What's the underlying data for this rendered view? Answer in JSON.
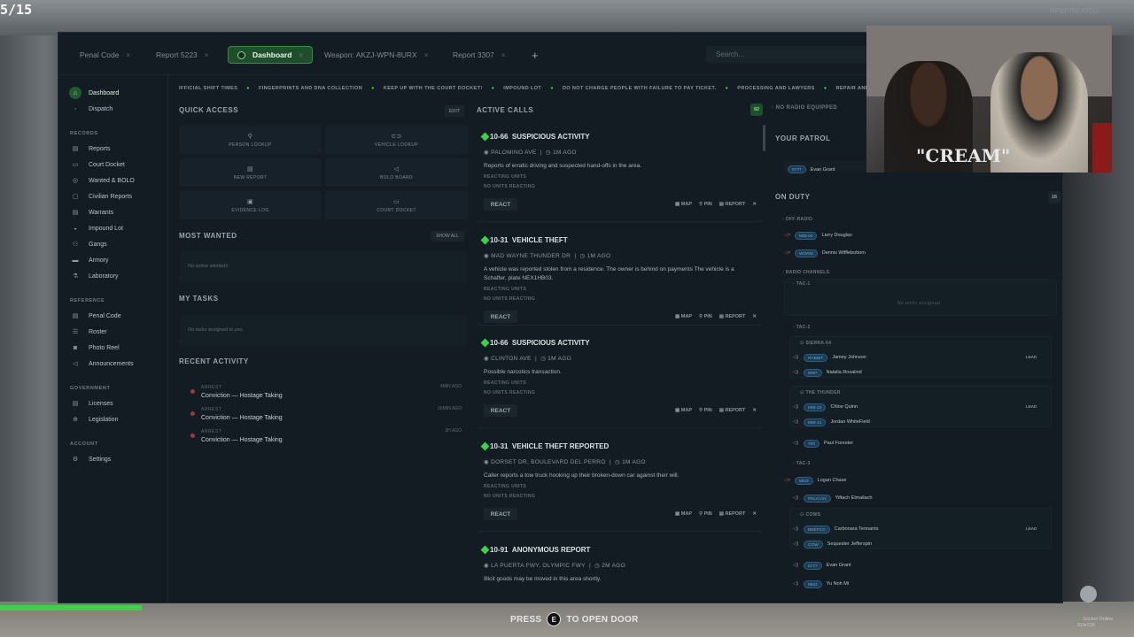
{
  "overlay": {
    "counter": "5/15",
    "watermark": "RPBP/SEATOJ",
    "prompt_press": "PRESS",
    "prompt_key": "E",
    "prompt_action": "TO OPEN DOOR",
    "socket_status": "Socket Online",
    "socket_id": "01fe209"
  },
  "tabs": [
    {
      "label": "Penal Code"
    },
    {
      "label": "Report 5223"
    },
    {
      "label": "Dashboard"
    },
    {
      "label": "Weapon: AKZJ-WPN-8URX"
    },
    {
      "label": "Report 3307"
    }
  ],
  "tab_close": "×",
  "tab_add": "+",
  "search": {
    "placeholder": "Search..."
  },
  "sidebar": {
    "top": [
      {
        "label": "Dashboard",
        "icon": "home-icon"
      },
      {
        "label": "Dispatch",
        "icon": "radio-icon"
      }
    ],
    "records_title": "RECORDS",
    "records": [
      {
        "label": "Reports",
        "icon": "document-icon"
      },
      {
        "label": "Court Docket",
        "icon": "gavel-icon"
      },
      {
        "label": "Wanted & BOLO",
        "icon": "target-icon"
      },
      {
        "label": "Civilian Reports",
        "icon": "chat-icon"
      },
      {
        "label": "Warrants",
        "icon": "warrant-icon"
      },
      {
        "label": "Impound Lot",
        "icon": "car-icon"
      },
      {
        "label": "Gangs",
        "icon": "users-icon"
      },
      {
        "label": "Armory",
        "icon": "gun-icon"
      },
      {
        "label": "Laboratory",
        "icon": "flask-icon"
      }
    ],
    "reference_title": "REFERENCE",
    "reference": [
      {
        "label": "Penal Code",
        "icon": "book-icon"
      },
      {
        "label": "Roster",
        "icon": "roster-icon"
      },
      {
        "label": "Photo Reel",
        "icon": "camera-icon"
      },
      {
        "label": "Announcements",
        "icon": "megaphone-icon"
      }
    ],
    "government_title": "GOVERNMENT",
    "government": [
      {
        "label": "Licenses",
        "icon": "license-icon"
      },
      {
        "label": "Legislation",
        "icon": "legislation-icon"
      }
    ],
    "account_title": "ACCOUNT",
    "account": [
      {
        "label": "Settings",
        "icon": "gear-icon"
      }
    ]
  },
  "ticker": [
    "IFFICIAL SHIFT TIMES",
    "FINGERPRINTS AND DNA COLLECTION",
    "KEEP UP WITH THE COURT DOCKET!",
    "IMPOUND LOT",
    "DO NOT CHARGE PEOPLE WITH FAILURE TO PAY TICKET.",
    "PROCESSING AND LAWYERS",
    "REPAIR AND"
  ],
  "quick_access": {
    "title": "QUICK ACCESS",
    "edit": "EDIT",
    "buttons": [
      {
        "label": "PERSON LOOKUP",
        "icon": "person-icon"
      },
      {
        "label": "VEHICLE LOOKUP",
        "icon": "car-icon"
      },
      {
        "label": "NEW REPORT",
        "icon": "document-icon"
      },
      {
        "label": "BOLO BOARD",
        "icon": "megaphone-icon"
      },
      {
        "label": "EVIDENCE LOG",
        "icon": "box-icon"
      },
      {
        "label": "COURT DOCKET",
        "icon": "gavel-icon"
      }
    ]
  },
  "most_wanted": {
    "title": "MOST WANTED",
    "show_all": "SHOW ALL",
    "empty": "No active wanteds."
  },
  "my_tasks": {
    "title": "MY TASKS",
    "empty": "No tasks assigned to you."
  },
  "recent_activity": {
    "title": "RECENT ACTIVITY",
    "items": [
      {
        "type": "ARREST",
        "text": "Conviction — Hostage Taking",
        "ago": "4MIN AGO"
      },
      {
        "type": "ARREST",
        "text": "Conviction — Hostage Taking",
        "ago": "16MIN AGO"
      },
      {
        "type": "ARREST",
        "text": "Conviction — Hostage Taking",
        "ago": "2H AGO"
      }
    ]
  },
  "active_calls": {
    "title": "ACTIVE CALLS",
    "count": "82",
    "responding_label": "REACTING UNITS",
    "no_units": "NO UNITS REACTING",
    "react": "REACT",
    "map": "MAP",
    "pin": "PIN",
    "report": "REPORT",
    "calls": [
      {
        "code": "10-66",
        "title": "SUSPICIOUS ACTIVITY",
        "location": "PALOMINO AVE",
        "ago": "1M AGO",
        "desc": "Reports of erratic driving and suspected hand-offs in the area."
      },
      {
        "code": "10-31",
        "title": "VEHICLE THEFT",
        "location": "MAD WAYNE THUNDER DR",
        "ago": "1M AGO",
        "desc": "A vehicle was reported stolen from a residence. The owner is behind on payments The vehicle is a Schafter, plate NEX1HB03."
      },
      {
        "code": "10-66",
        "title": "SUSPICIOUS ACTIVITY",
        "location": "CLINTON AVE",
        "ago": "1M AGO",
        "desc": "Possible narcotics transaction."
      },
      {
        "code": "10-31",
        "title": "VEHICLE THEFT REPORTED",
        "location": "DORSET DR, BOULEVARD DEL PERRO",
        "ago": "1M AGO",
        "desc": "Caller reports a tow truck hooking up their broken-down car against their will."
      },
      {
        "code": "10-91",
        "title": "ANONYMOUS REPORT",
        "location": "LA PUERTA FWY, OLYMPIC FWY",
        "ago": "2M AGO",
        "desc": "Illicit goods may be moved in this area shortly."
      }
    ]
  },
  "radio": {
    "status": "NO RADIO EQUIPPED"
  },
  "patrol": {
    "title": "YOUR PATROL",
    "callsign": "5777",
    "name": "Evan Grant"
  },
  "on_duty": {
    "title": "ON DUTY",
    "count": "16",
    "off_radio_title": "OFF-RADIO",
    "off_radio": [
      {
        "callsign": "MIB-04",
        "name": "Larry Douglas"
      },
      {
        "callsign": "WORM",
        "name": "Dennis Wifflebottom"
      }
    ],
    "radio_channels_title": "RADIO CHANNELS",
    "tac1": "TAC-1",
    "tac1_empty": "No units assigned",
    "tac2": "TAC-2",
    "sierra": "SIERRA-54",
    "sierra_units": [
      {
        "callsign": "RABBIT",
        "name": "Jamey Johnson",
        "lead": "LEAD"
      },
      {
        "callsign": "8087",
        "name": "Natalia Rosalind",
        "lead": ""
      }
    ],
    "thunder": "THE THUNDER",
    "thunder_units": [
      {
        "callsign": "MIB-10",
        "name": "Chloe Quinn",
        "lead": "LEAD"
      },
      {
        "callsign": "MIB-12",
        "name": "Jordan WhiteField",
        "lead": ""
      }
    ],
    "tac2_solo": {
      "callsign": "700",
      "name": "Paul Forester"
    },
    "tac3": "TAC-3",
    "tac3_units": [
      {
        "callsign": "8823",
        "name": "Logan Chase"
      },
      {
        "callsign": "PELICAN",
        "name": "Yiftach Elmaliach"
      }
    ],
    "cows": "COWS",
    "cows_units": [
      {
        "callsign": "BEEFCO",
        "name": "Carbonara Tennants",
        "lead": "LEAD"
      },
      {
        "callsign": "COW",
        "name": "Sequester Jefferspin",
        "lead": ""
      }
    ],
    "tail_units": [
      {
        "callsign": "5777",
        "name": "Evan Grant"
      },
      {
        "callsign": "9822",
        "name": "Yu Noh Mi"
      }
    ]
  },
  "colors": {
    "accent": "#3bd14b",
    "panel": "#121c22",
    "badge": "#5fa6d6"
  },
  "webcam": {
    "shirt_text": "\"CREAM\""
  }
}
